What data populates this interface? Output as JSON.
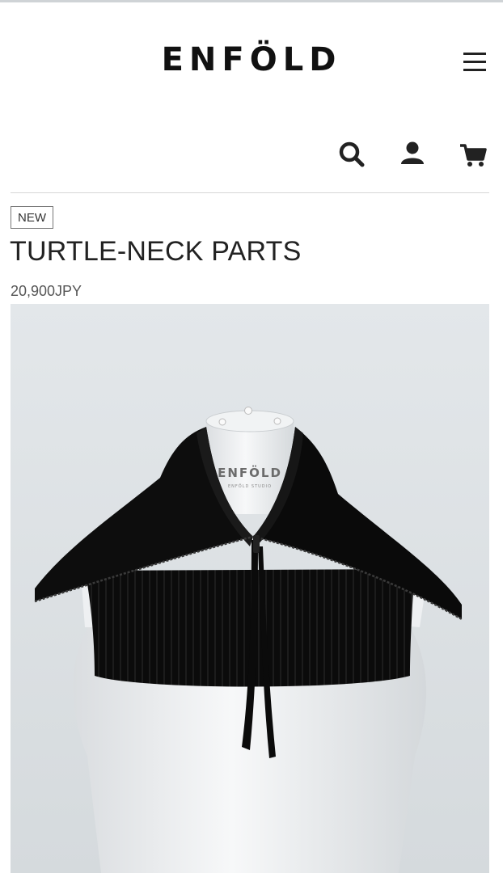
{
  "header": {
    "brand": "ENFÖLD",
    "icons": [
      "menu-icon",
      "search-icon",
      "user-icon",
      "cart-icon"
    ]
  },
  "product": {
    "badge": "NEW",
    "name": "TURTLE-NECK PARTS",
    "price": "20,900JPY",
    "image": {
      "mannequin_label": "ENFÖLD",
      "mannequin_sublabel": "ENFÖLD STUDIO",
      "garment_color": "#0b0b0b",
      "background_color": "#e1e5e8"
    }
  }
}
